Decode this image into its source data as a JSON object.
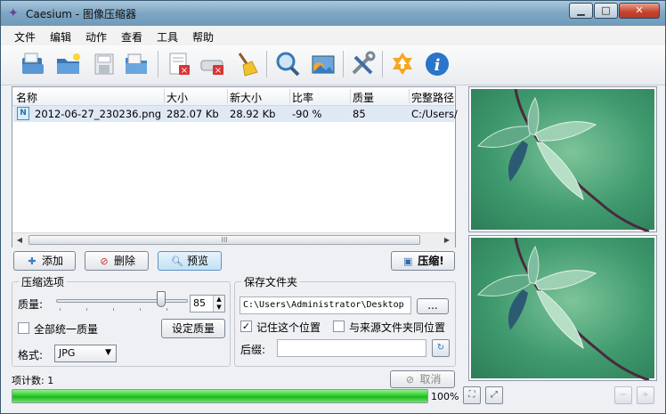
{
  "window": {
    "title": "Caesium - 图像压缩器",
    "controls": {
      "minimize": "▁",
      "maximize": "□",
      "close": "✕"
    }
  },
  "menu": [
    "文件",
    "编辑",
    "动作",
    "查看",
    "工具",
    "帮助"
  ],
  "toolbar_icons": [
    "open-file-icon",
    "open-folder-icon",
    "save-icon",
    "save-list-icon",
    "remove-item-icon",
    "remove-all-icon",
    "clear-icon",
    "zoom-preview-icon",
    "image-preview-icon",
    "settings-tools-icon",
    "update-icon",
    "info-icon"
  ],
  "file_list": {
    "columns": [
      "名称",
      "大小",
      "新大小",
      "比率",
      "质量",
      "完整路径"
    ],
    "rows": [
      {
        "icon": "N",
        "name": "2012-06-27_230236.png",
        "size": "282.07 Kb",
        "new_size": "28.92 Kb",
        "ratio": "-90 %",
        "quality": "85",
        "path": "C:/Users/"
      }
    ],
    "scroll_grip": "III"
  },
  "actions": {
    "add": "添加",
    "delete": "删除",
    "preview": "预览",
    "compress": "压缩!"
  },
  "compression": {
    "group_title": "压缩选项",
    "quality_label": "质量:",
    "quality_value": "85",
    "quality_level": 0.85,
    "same_quality_label": "全部统一质量",
    "set_quality": "设定质量",
    "format_label": "格式:",
    "format_value": "JPG"
  },
  "output": {
    "group_title": "保存文件夹",
    "folder_path": "C:\\Users\\Administrator\\Desktop",
    "browse": "...",
    "remember_label": "记住这个位置",
    "remember_checked": true,
    "same_as_source_label": "与来源文件夹同位置",
    "same_as_source_checked": false,
    "suffix_label": "后缀:",
    "suffix_value": ""
  },
  "status": {
    "items_label": "项计数: 1",
    "cancel": "取消",
    "progress_text": "100%",
    "progress_fraction": 1.0
  },
  "preview_controls": {
    "fit": "⛶",
    "zoom_full": "⤢",
    "zoom_out": "−",
    "zoom_in": "+"
  },
  "colors": {
    "accent": "#2ecb2e",
    "selection": "#dfe8f5",
    "title_bar": "#7ea6c3"
  }
}
